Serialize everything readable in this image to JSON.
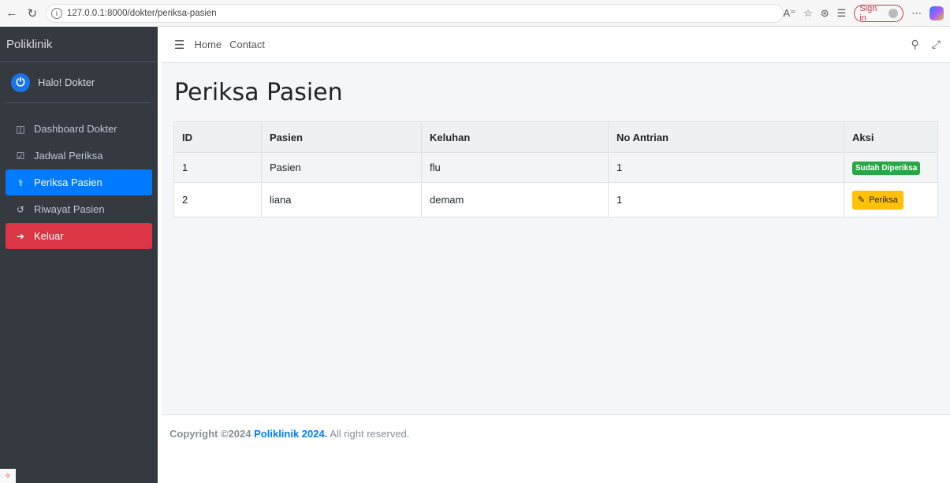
{
  "browser": {
    "url": "127.0.0.1:8000/dokter/periksa-pasien",
    "signin_label": "Sign in"
  },
  "sidebar": {
    "brand": "Poliklinik",
    "user_name": "Halo! Dokter",
    "items": [
      {
        "label": "Dashboard Dokter",
        "icon": "dashboard-icon"
      },
      {
        "label": "Jadwal Periksa",
        "icon": "calendar-check-icon"
      },
      {
        "label": "Periksa Pasien",
        "icon": "stethoscope-icon",
        "active": true
      },
      {
        "label": "Riwayat Pasien",
        "icon": "history-icon"
      },
      {
        "label": "Keluar",
        "icon": "sign-out-icon",
        "danger": true
      }
    ]
  },
  "topnav": {
    "home": "Home",
    "contact": "Contact"
  },
  "main": {
    "title": "Periksa Pasien",
    "table": {
      "headers": [
        "ID",
        "Pasien",
        "Keluhan",
        "No Antrian",
        "Aksi"
      ],
      "rows": [
        {
          "id": "1",
          "pasien": "Pasien",
          "keluhan": "flu",
          "no_antrian": "1",
          "aksi": "Sudah Diperiksa",
          "aksi_type": "badge"
        },
        {
          "id": "2",
          "pasien": "liana",
          "keluhan": "demam",
          "no_antrian": "1",
          "aksi": "Periksa",
          "aksi_type": "button"
        }
      ]
    }
  },
  "footer": {
    "prefix": "Copyright ©2024",
    "brand": "Poliklinik 2024.",
    "suffix": "All right reserved."
  },
  "colors": {
    "sidebar_bg": "#343a40",
    "active": "#007bff",
    "danger": "#dc3545",
    "success": "#28a745",
    "warning": "#ffc107"
  }
}
